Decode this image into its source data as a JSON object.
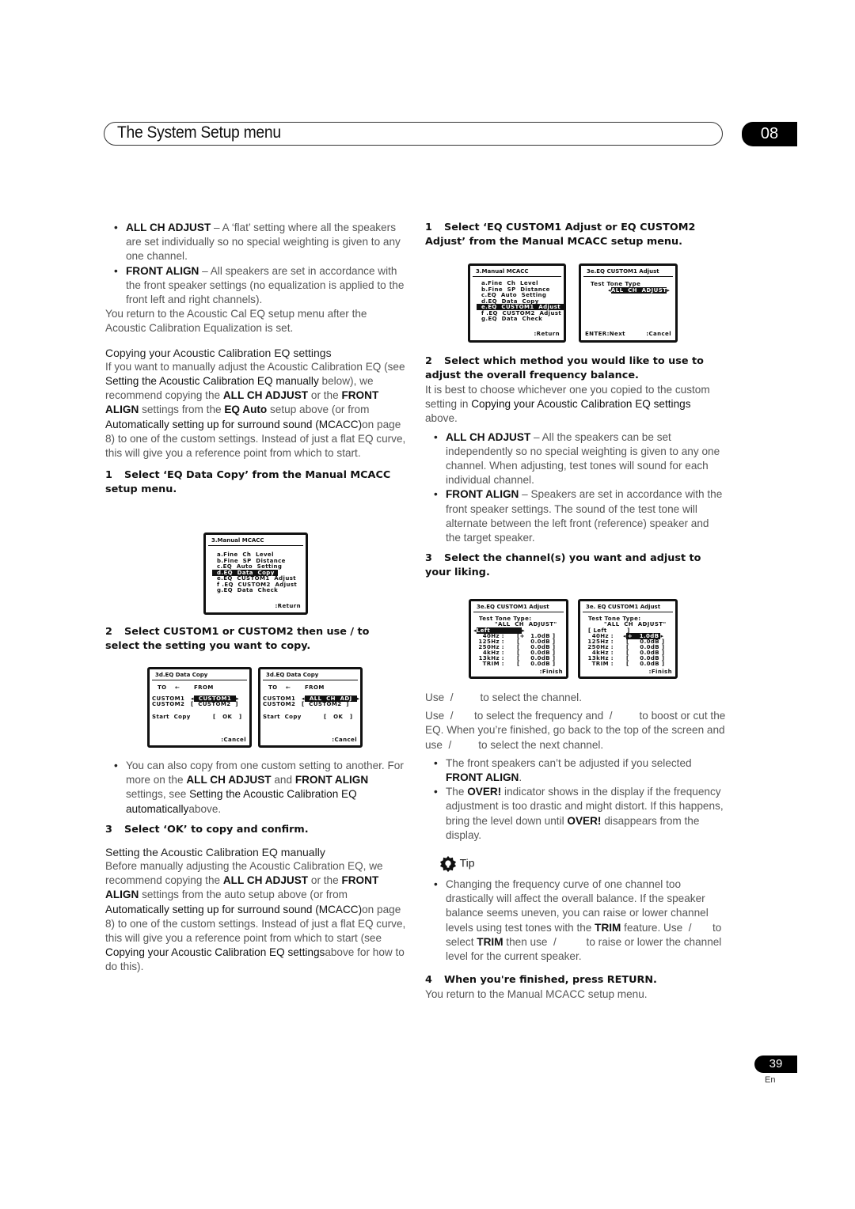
{
  "header": {
    "title": "The System Setup menu",
    "chapter": "08"
  },
  "left": {
    "bullets_top": [
      {
        "term": "ALL CH ADJUST",
        "text": " – A ‘flat’ setting where all the speakers are set individually so no special weighting is given to any one channel."
      },
      {
        "term": "FRONT ALIGN",
        "text": " – All speakers are set in accordance with the front speaker settings (no equalization is applied to the front left and right channels)."
      }
    ],
    "return_note": "You return to the Acoustic Cal EQ setup menu after the Acoustic Calibration Equalization is set.",
    "copy_heading": "Copying your Acoustic Calibration EQ settings",
    "copy_para": {
      "p1": "If you want to manually adjust the Acoustic Calibration EQ (see ",
      "ref1": "Setting the Acoustic Calibration EQ manually",
      "p2": " below), we recommend copying the ",
      "b1": "ALL CH ADJUST",
      "p3": " or the ",
      "b2": "FRONT ALIGN",
      "p4": " settings from the ",
      "b3": "EQ Auto",
      "p5": " setup above (or from ",
      "ref2": "Automatically setting up for surround sound (MCACC)",
      "p6": "on page 8) to one of the custom settings. Instead of just a flat EQ curve, this will give you a reference point from which to start."
    },
    "step1": {
      "num": "1",
      "text": "Select ‘EQ Data Copy’ from the Manual MCACC setup menu."
    },
    "osd_menu": {
      "title": "3.Manual  MCACC",
      "items": [
        "a.Fine  Ch  Level",
        "b.Fine  SP  Distance",
        "c.EQ  Auto  Setting",
        "d.EQ  Data  Copy",
        "e.EQ  CUSTOM1  Adjust",
        "f .EQ  CUSTOM2  Adjust",
        "g.EQ  Data  Check"
      ],
      "selected_index": 3,
      "footer": ":Return"
    },
    "step2": {
      "num": "2",
      "text": "Select CUSTOM1 or CUSTOM2 then use  /          to select the setting you want to copy."
    },
    "osd_copy_a": {
      "title": "3d.EQ  Data  Copy",
      "to": "TO",
      "arrow": "←",
      "from": "FROM",
      "row1_label": "CUSTOM1",
      "row1_value": "CUSTOM1",
      "row2_label": "CUSTOM2",
      "row2_value": "CUSTOM2",
      "start": "Start  Copy",
      "ok": "OK",
      "footer": ":Cancel"
    },
    "osd_copy_b": {
      "title": "3d.EQ  Data  Copy",
      "to": "TO",
      "arrow": "←",
      "from": "FROM",
      "row1_label": "CUSTOM1",
      "row1_value": "ALL  CH  ADJ",
      "row2_label": "CUSTOM2",
      "row2_value": "CUSTOM2",
      "start": "Start  Copy",
      "ok": "OK",
      "footer": ":Cancel"
    },
    "copy_bullet": {
      "p1": "You can also copy from one custom setting to another. For more on the ",
      "b1": "ALL CH ADJUST",
      "p2": " and ",
      "b2": "FRONT ALIGN",
      "p3": " settings, see ",
      "ref": "Setting the Acoustic Calibration EQ automatically",
      "p4": "above."
    },
    "step3": {
      "num": "3",
      "text": "Select ‘OK’ to copy and confirm."
    },
    "manual_heading": "Setting the Acoustic Calibration EQ manually",
    "manual_para": {
      "p1": "Before manually adjusting the Acoustic Calibration EQ, we recommend copying the ",
      "b1": "ALL CH ADJUST",
      "p2": " or the ",
      "b2": "FRONT ALIGN",
      "p3": " settings from the auto setup above (or from ",
      "ref1": "Automatically setting up for surround sound (MCACC)",
      "p4": "on page 8) to one of the custom settings. Instead of just a flat EQ curve, this will give you a reference point from which to start (see ",
      "ref2": "Copying your Acoustic Calibration EQ settings",
      "p5": "above for how to do this)."
    }
  },
  "right": {
    "step1": {
      "num": "1",
      "text": "Select ‘EQ CUSTOM1 Adjust or EQ CUSTOM2 Adjust’ from the Manual MCACC setup menu."
    },
    "osd_menu": {
      "title": "3.Manual  MCACC",
      "items": [
        "a.Fine  Ch  Level",
        "b.Fine  SP  Distance",
        "c.EQ  Auto  Setting",
        "d.EQ  Data  Copy",
        "e.EQ  CUSTOM1  Adjust",
        "f .EQ  CUSTOM2  Adjust",
        "g.EQ  Data  Check"
      ],
      "selected_index": 4,
      "footer": ":Return"
    },
    "osd_tone": {
      "title": "3e.EQ  CUSTOM1  Adjust",
      "label": "Test Tone Type",
      "value": "ALL  CH  ADJUST",
      "footer_left": "ENTER:Next",
      "footer_right": ":Cancel"
    },
    "step2": {
      "num": "2",
      "text": "Select which method you would like to use to adjust the overall frequency balance."
    },
    "step2_para": {
      "p1": "It is best to choose whichever one you copied to the custom setting in ",
      "ref": "Copying your Acoustic Calibration EQ settings",
      "p2": " above."
    },
    "bullets": [
      {
        "term": "ALL CH ADJUST",
        "text": " – All the speakers can be set independently so no special weighting is given to any one channel. When adjusting, test tones will sound for each individual channel."
      },
      {
        "term": "FRONT ALIGN",
        "text": " – Speakers are set in accordance with the front speaker settings. The sound of the test tone will alternate between the left front (reference) speaker and the target speaker."
      }
    ],
    "step3": {
      "num": "3",
      "text": "Select the channel(s) you want and adjust to your liking."
    },
    "osd_eq_a": {
      "title": "3e.EQ  CUSTOM1  Adjust",
      "type_label": "Test Tone Type:",
      "type_value": "\"ALL  CH  ADJUST\"",
      "channel": "Left",
      "rows": [
        {
          "f": "40Hz :",
          "v": "1.0dB",
          "s": "+"
        },
        {
          "f": "125Hz :",
          "v": "0.0dB",
          "s": ""
        },
        {
          "f": "250Hz :",
          "v": "0.0dB",
          "s": ""
        },
        {
          "f": "4kHz :",
          "v": "0.0dB",
          "s": ""
        },
        {
          "f": "13kHz :",
          "v": "0.0dB",
          "s": ""
        },
        {
          "f": "TRIM :",
          "v": "0.0dB",
          "s": ""
        }
      ],
      "footer": ":Finish"
    },
    "osd_eq_b": {
      "title": "3e. EQ  CUSTOM1  Adjust",
      "type_label": "Test Tone Type:",
      "type_value": "\"ALL  CH  ADJUST\"",
      "channel": "Left",
      "rows": [
        {
          "f": "40Hz :",
          "v": "1.0dB",
          "s": "+"
        },
        {
          "f": "125Hz :",
          "v": "0.0dB",
          "s": ""
        },
        {
          "f": "250Hz :",
          "v": "0.0dB",
          "s": ""
        },
        {
          "f": "4kHz :",
          "v": "0.0dB",
          "s": ""
        },
        {
          "f": "13kHz :",
          "v": "0.0dB",
          "s": ""
        },
        {
          "f": "TRIM :",
          "v": "0.0dB",
          "s": ""
        }
      ],
      "footer": ":Finish"
    },
    "use1": "Use  /         to select the channel.",
    "use2": "Use  /       to select the frequency and  /         to boost or cut the EQ. When you’re finished, go back to the top of the screen and use  /         to select the next channel.",
    "note_bullets": [
      {
        "p1": "The front speakers can’t be adjusted if you selected ",
        "b": "FRONT ALIGN",
        "p2": "."
      },
      {
        "p1": "The ",
        "b": "OVER!",
        "p2": " indicator shows in the display if the frequency adjustment is too drastic and might distort. If this happens, bring the level down until ",
        "b2": "OVER!",
        "p3": " disappears from the display."
      }
    ],
    "tip_label": "Tip",
    "tip": {
      "p1": "Changing the frequency curve of one channel too drastically will affect the overall balance. If the speaker balance seems uneven, you can raise or lower channel levels using test tones with the ",
      "b1": "TRIM",
      "p2": " feature. Use  /       to select ",
      "b2": "TRIM",
      "p3": " then use  /          to raise or lower the channel level for the current speaker."
    },
    "step4": {
      "num": "4",
      "text": "When you're finished, press RETURN."
    },
    "step4_para": "You return to the Manual MCACC setup menu."
  },
  "footer": {
    "page": "39",
    "lang": "En"
  }
}
